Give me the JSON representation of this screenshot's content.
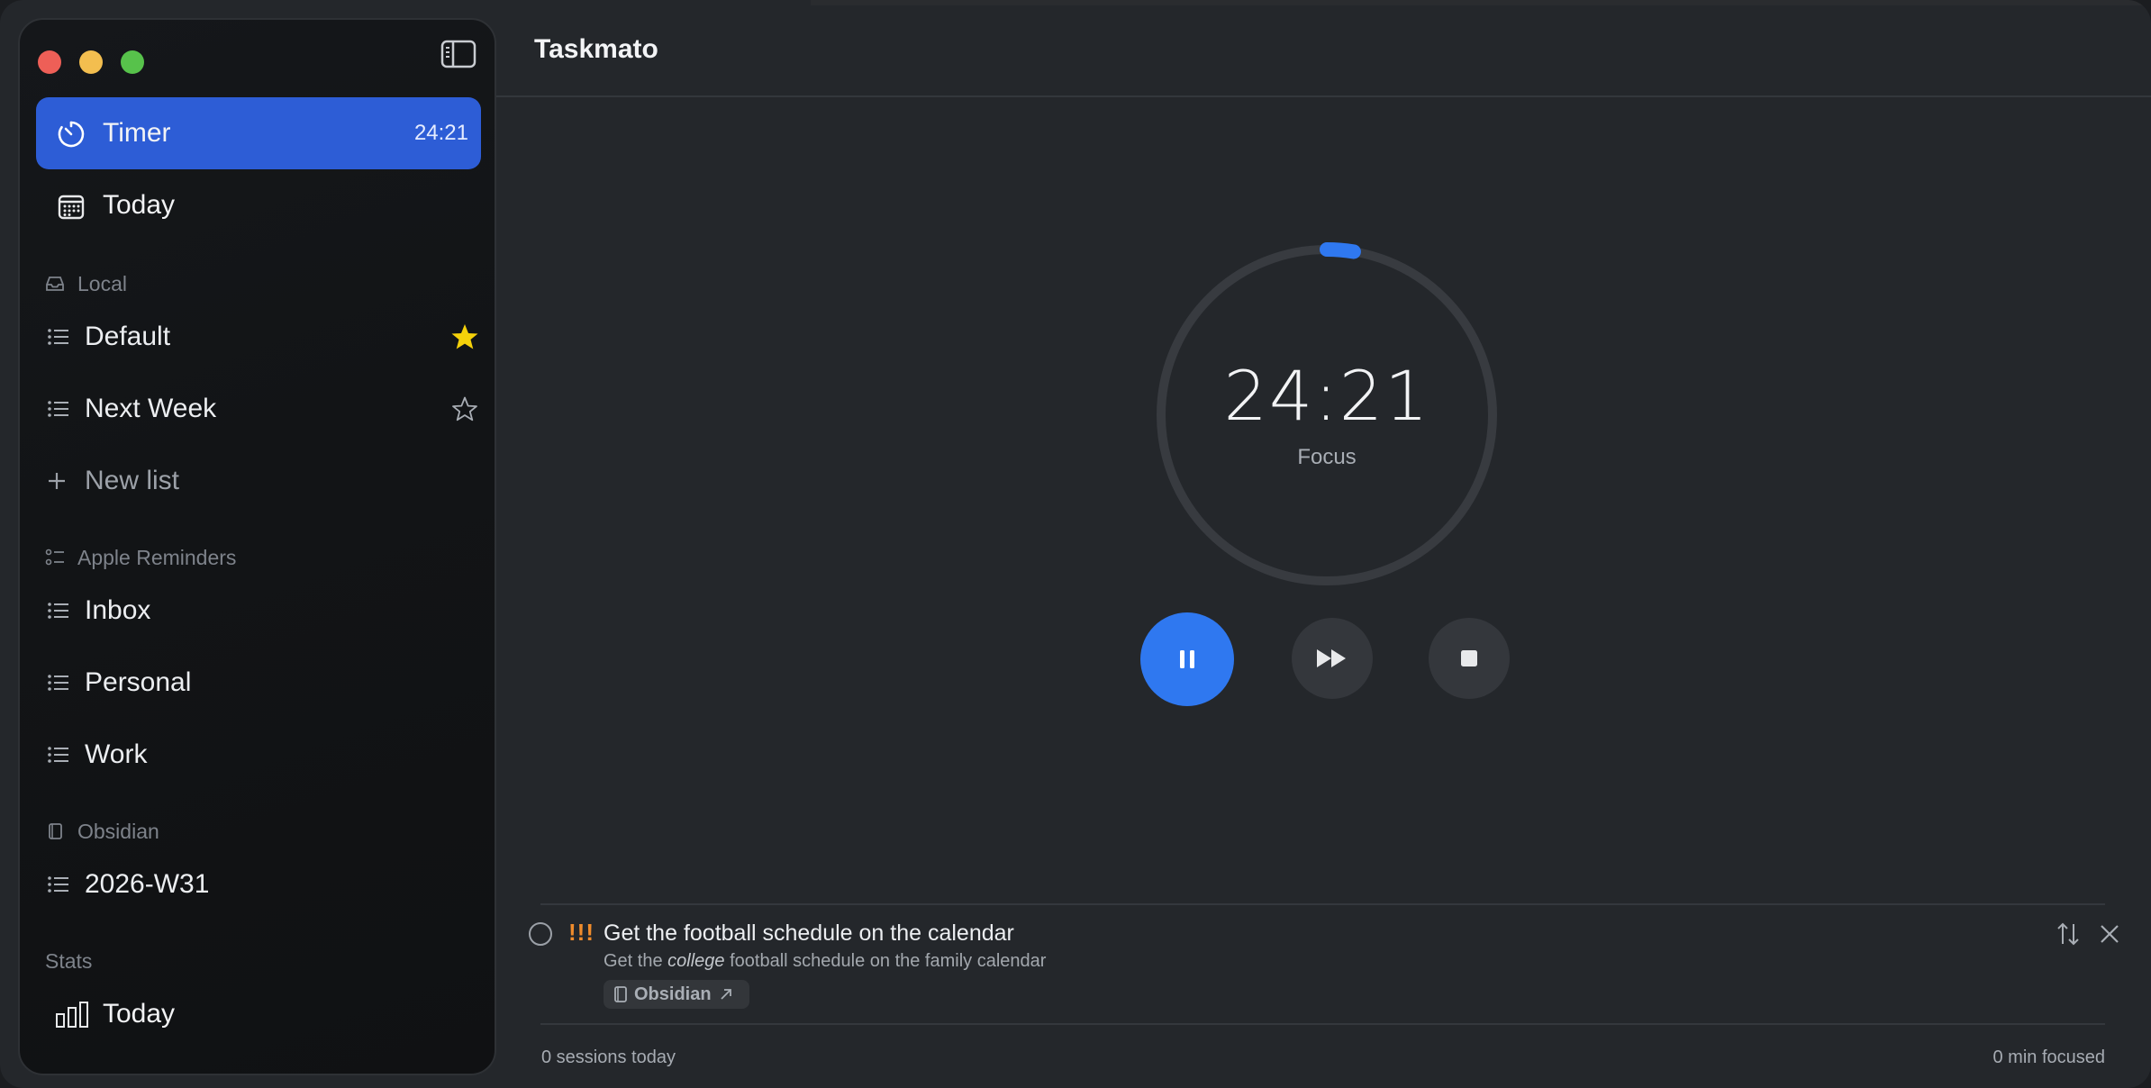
{
  "app": {
    "title": "Taskmato"
  },
  "sidebar": {
    "nav": [
      {
        "label": "Timer",
        "badge": "24:21",
        "icon": "timer-icon",
        "active": true
      },
      {
        "label": "Today",
        "icon": "calendar-icon",
        "active": false
      }
    ],
    "sections": {
      "local": "Local",
      "apple": "Apple Reminders",
      "obsidian": "Obsidian",
      "stats": "Stats"
    },
    "local_lists": [
      {
        "label": "Default",
        "starred": true
      },
      {
        "label": "Next Week",
        "starred": false
      }
    ],
    "new_list_label": "New list",
    "apple_lists": [
      {
        "label": "Inbox"
      },
      {
        "label": "Personal"
      },
      {
        "label": "Work"
      }
    ],
    "obsidian_lists": [
      {
        "label": "2026-W31"
      }
    ],
    "stats_items": [
      {
        "label": "Today",
        "icon": "bar-chart-icon"
      }
    ]
  },
  "timer": {
    "time": "24:21",
    "mode": "Focus",
    "progress": 0.026
  },
  "colors": {
    "accent": "#2f78f0",
    "sidebar_active": "#2d5dd6",
    "priority": "#f08c2c",
    "star": "#f5d10a"
  },
  "task": {
    "priority": "!!!",
    "title": "Get the football schedule on the calendar",
    "notes_before": "Get the ",
    "notes_em": "college",
    "notes_after": " football schedule on the family calendar",
    "tag": "Obsidian"
  },
  "footer": {
    "sessions": "0 sessions today",
    "focused": "0 min focused"
  }
}
